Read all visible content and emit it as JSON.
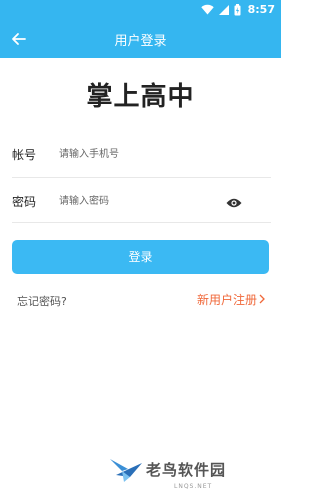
{
  "status_bar": {
    "time": "8:57"
  },
  "app_bar": {
    "title": "用户登录"
  },
  "app_name": "掌上高中",
  "form": {
    "account": {
      "label": "帐号",
      "placeholder": "请输入手机号"
    },
    "password": {
      "label": "密码",
      "placeholder": "请输入密码"
    },
    "login_label": "登录"
  },
  "links": {
    "forgot": "忘记密码?",
    "register": "新用户注册"
  },
  "watermark": {
    "text": "老鸟软件园",
    "domain": "LNQS.NET"
  },
  "colors": {
    "primary": "#35b6f0",
    "button": "#3bb9f3",
    "register": "#f0683a"
  }
}
